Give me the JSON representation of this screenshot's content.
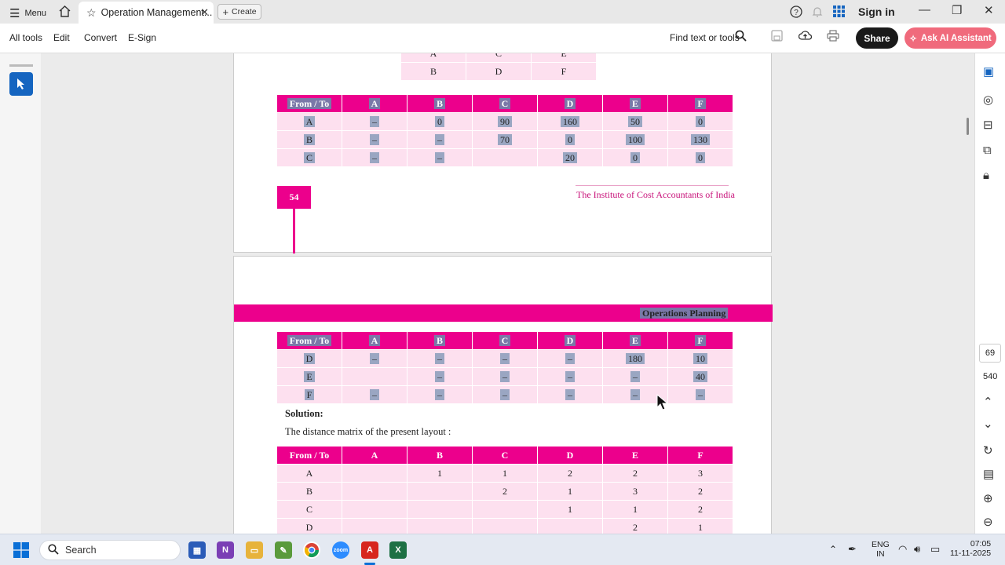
{
  "titlebar": {
    "menu_label": "Menu",
    "tab_title": "Operation Management...",
    "create_label": "Create",
    "sign_in": "Sign in"
  },
  "toolbar": {
    "items": [
      "All tools",
      "Edit",
      "Convert",
      "E-Sign"
    ],
    "find_label": "Find text or tools",
    "share_label": "Share",
    "ai_label": "Ask AI Assistant"
  },
  "right_panel": {
    "page_current": "69",
    "page_total": "540"
  },
  "page1": {
    "top_table_rows": [
      [
        "A",
        "C",
        "E"
      ],
      [
        "B",
        "D",
        "F"
      ]
    ],
    "table": {
      "headers": [
        "From / To",
        "A",
        "B",
        "C",
        "D",
        "E",
        "F"
      ],
      "rows": [
        [
          "A",
          "–",
          "0",
          "90",
          "160",
          "50",
          "0"
        ],
        [
          "B",
          "–",
          "–",
          "70",
          "0",
          "100",
          "130"
        ],
        [
          "C",
          "–",
          "–",
          "",
          "20",
          "0",
          "0"
        ]
      ]
    },
    "page_number": "54",
    "institute": "The Institute of Cost Accountants of India"
  },
  "page2": {
    "section_title": "Operations Planning",
    "table": {
      "headers": [
        "From / To",
        "A",
        "B",
        "C",
        "D",
        "E",
        "F"
      ],
      "rows": [
        [
          "D",
          "–",
          "–",
          "–",
          "–",
          "180",
          "10"
        ],
        [
          "E",
          "",
          "–",
          "–",
          "–",
          "–",
          "40"
        ],
        [
          "F",
          "–",
          "–",
          "–",
          "–",
          "–",
          "–"
        ]
      ]
    },
    "solution_label": "Solution:",
    "solution_text": "The distance matrix of the present layout :",
    "distance_table": {
      "headers": [
        "From / To",
        "A",
        "B",
        "C",
        "D",
        "E",
        "F"
      ],
      "rows": [
        [
          "A",
          "",
          "1",
          "1",
          "2",
          "2",
          "3"
        ],
        [
          "B",
          "",
          "",
          "2",
          "1",
          "3",
          "2"
        ],
        [
          "C",
          "",
          "",
          "",
          "1",
          "1",
          "2"
        ],
        [
          "D",
          "",
          "",
          "",
          "",
          "2",
          "1"
        ]
      ]
    }
  },
  "taskbar": {
    "search_label": "Search",
    "lang_top": "ENG",
    "lang_bottom": "IN",
    "time": "07:05",
    "date": "11-11-2025"
  }
}
